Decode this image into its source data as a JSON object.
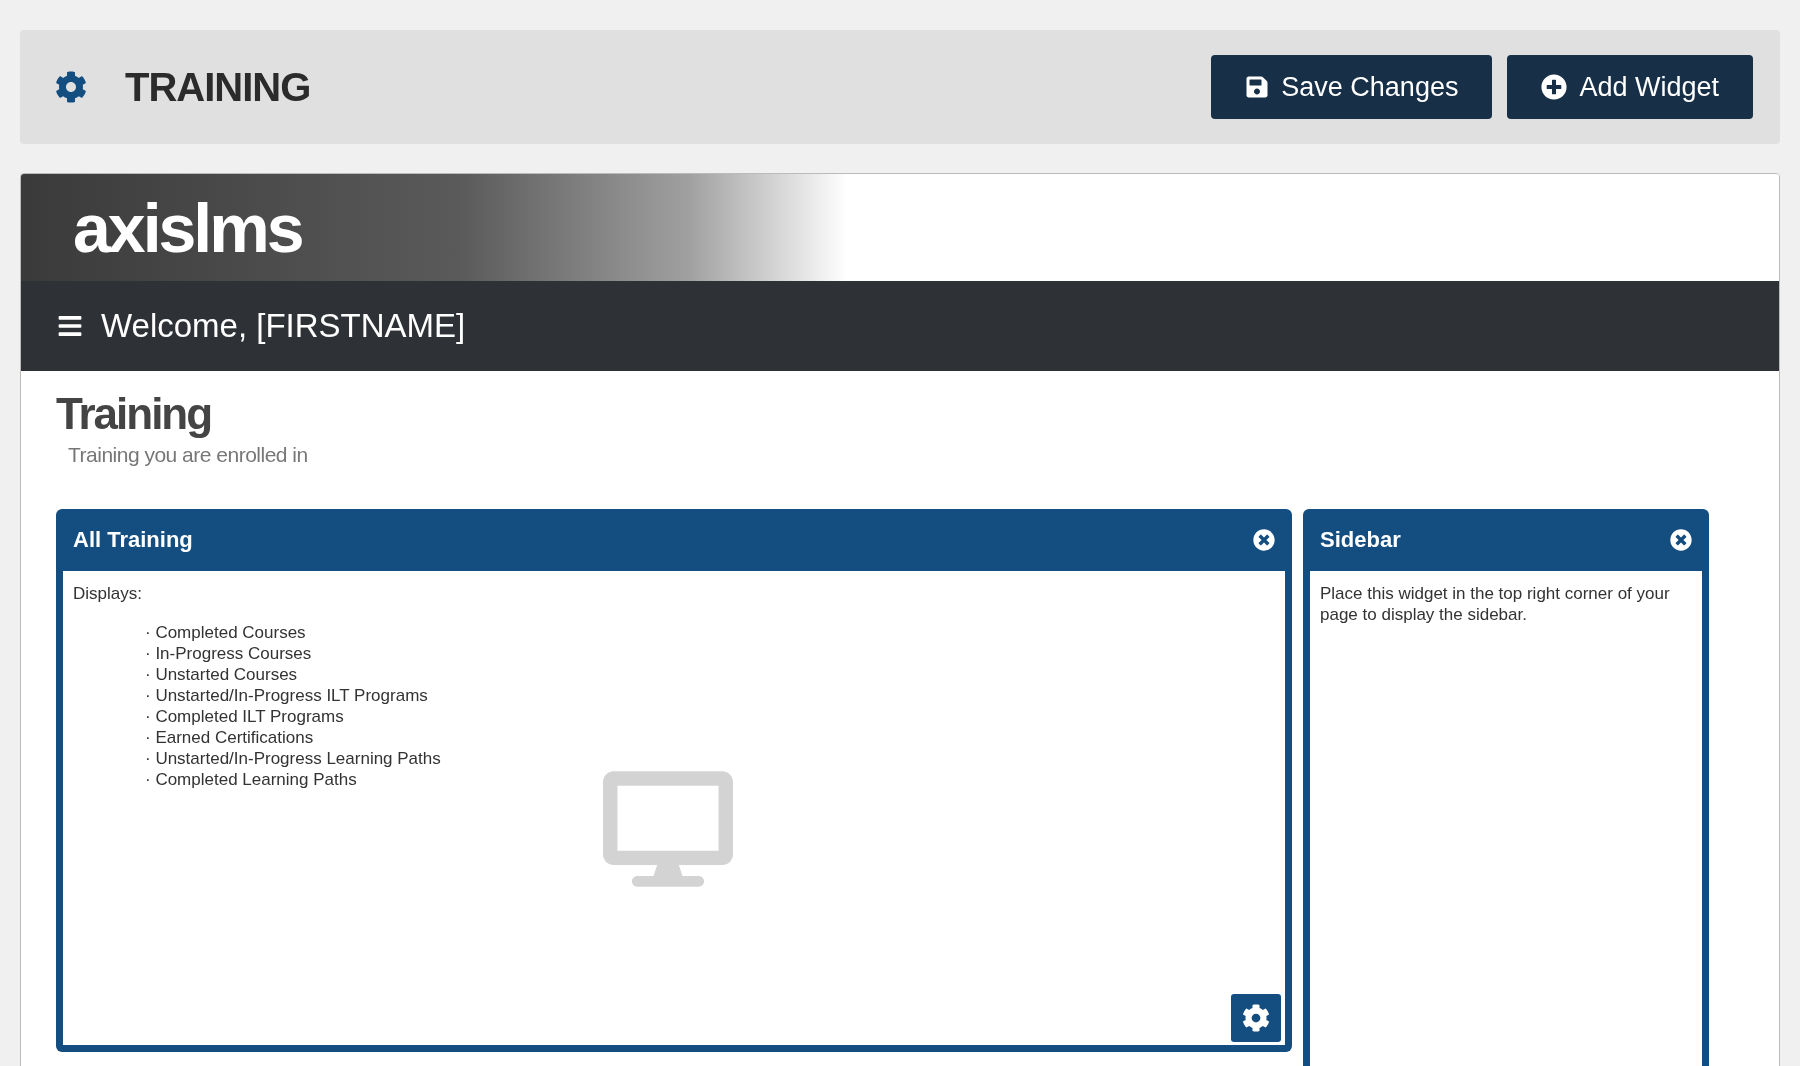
{
  "toolbar": {
    "title": "TRAINING",
    "buttons": [
      {
        "label": "Save Changes",
        "kind": "save"
      },
      {
        "label": "Add Widget",
        "kind": "add"
      }
    ]
  },
  "preview": {
    "logo": "axislms",
    "welcome": "Welcome, [FIRSTNAME]",
    "heading": "Training",
    "subheading": "Training you are enrolled in",
    "widgets": [
      {
        "title": "All Training",
        "kind": "training",
        "intro": "Displays:",
        "items": [
          "· Completed Courses",
          "· In-Progress Courses",
          "· Unstarted Courses",
          "· Unstarted/In-Progress ILT Programs",
          "· Completed ILT Programs",
          "· Earned Certifications",
          "· Unstarted/In-Progress Learning Paths",
          "· Completed Learning Paths"
        ]
      },
      {
        "title": "Sidebar",
        "kind": "sidebar",
        "text": "Place this widget in the top right corner of your page to display the sidebar."
      }
    ]
  }
}
